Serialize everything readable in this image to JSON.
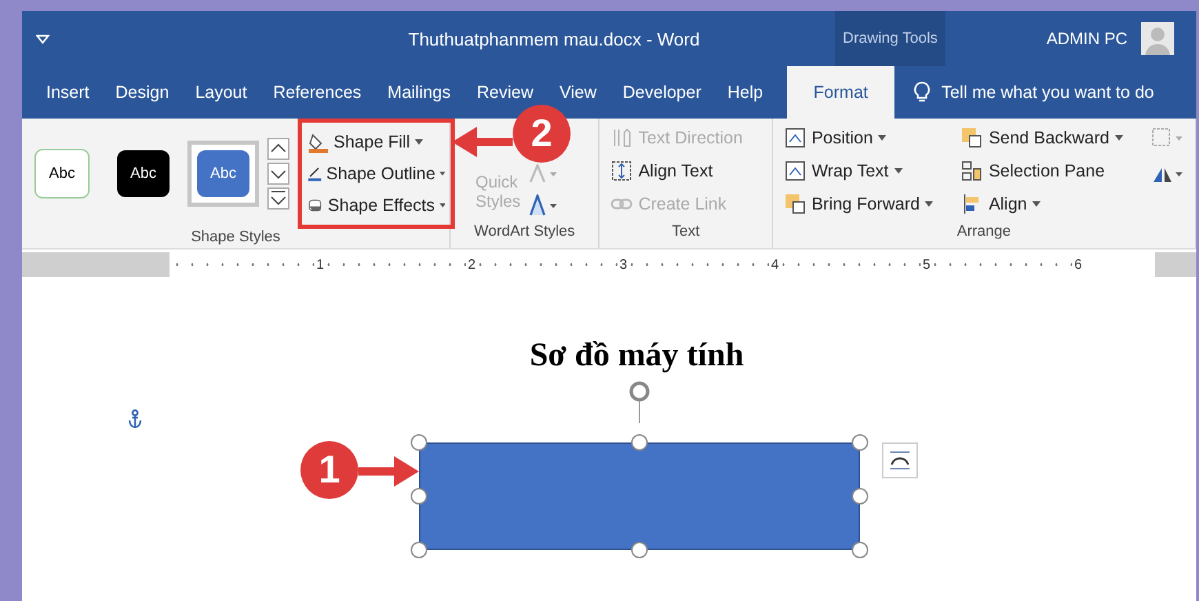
{
  "window": {
    "title": "Thuthuatphanmem mau.docx  -  Word",
    "context_tab": "Drawing Tools",
    "user": "ADMIN PC"
  },
  "tabs": [
    {
      "label": "Insert",
      "selected": false
    },
    {
      "label": "Design",
      "selected": false
    },
    {
      "label": "Layout",
      "selected": false
    },
    {
      "label": "References",
      "selected": false
    },
    {
      "label": "Mailings",
      "selected": false
    },
    {
      "label": "Review",
      "selected": false
    },
    {
      "label": "View",
      "selected": false
    },
    {
      "label": "Developer",
      "selected": false
    },
    {
      "label": "Help",
      "selected": false
    },
    {
      "label": "Format",
      "selected": true
    }
  ],
  "tell_me": "Tell me what you want to do",
  "shape_styles": {
    "label": "Shape Styles",
    "presets": [
      {
        "label": "Abc",
        "kind": "outline",
        "selected": false
      },
      {
        "label": "Abc",
        "kind": "dark",
        "selected": false
      },
      {
        "label": "Abc",
        "kind": "blue",
        "selected": true
      }
    ],
    "commands": [
      {
        "label": "Shape Fill",
        "kind": "fill"
      },
      {
        "label": "Shape Outline",
        "kind": "outline"
      },
      {
        "label": "Shape Effects",
        "kind": "effects"
      }
    ]
  },
  "wordart": {
    "label": "WordArt Styles",
    "quick_styles": "Quick Styles",
    "disabled": true
  },
  "text_group": {
    "label": "Text",
    "items": [
      {
        "label": "Text Direction",
        "kind": "direction",
        "disabled": true
      },
      {
        "label": "Align Text",
        "kind": "align",
        "disabled": false
      },
      {
        "label": "Create Link",
        "kind": "link",
        "disabled": true
      }
    ]
  },
  "arrange": {
    "label": "Arrange",
    "columns": [
      [
        {
          "label": "Position",
          "kind": "position",
          "menu": true
        },
        {
          "label": "Wrap Text",
          "kind": "wrap",
          "menu": true
        },
        {
          "label": "Bring Forward",
          "kind": "forward",
          "menu": true
        }
      ],
      [
        {
          "label": "Send Backward",
          "kind": "backward",
          "menu": true
        },
        {
          "label": "Selection Pane",
          "kind": "pane",
          "menu": false
        },
        {
          "label": "Align",
          "kind": "align",
          "menu": true
        }
      ]
    ]
  },
  "ruler": {
    "numbers": [
      "1",
      "2",
      "3",
      "4",
      "5",
      "6"
    ]
  },
  "document": {
    "heading": "Sơ đồ máy tính"
  },
  "callouts": [
    {
      "label": "1",
      "kind": "shape"
    },
    {
      "label": "2",
      "kind": "ribbon"
    }
  ]
}
